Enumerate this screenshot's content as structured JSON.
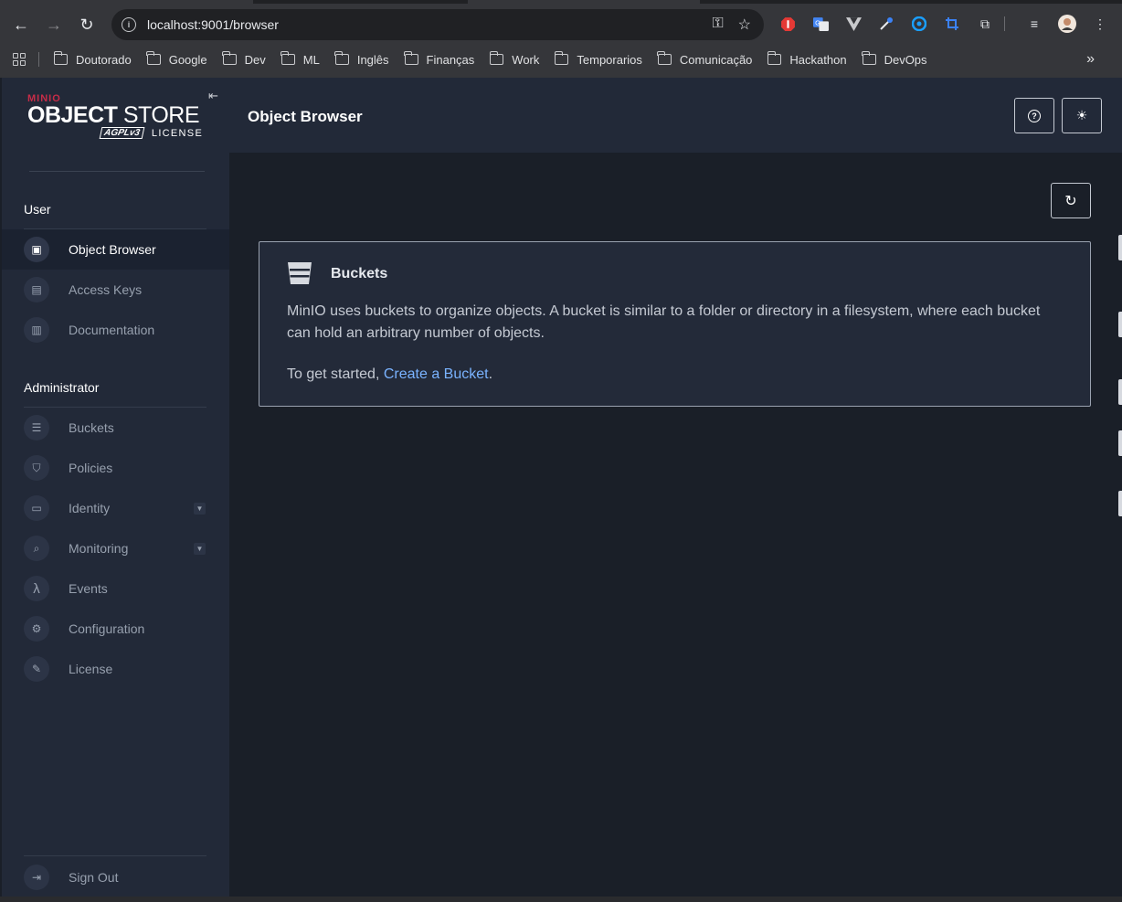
{
  "browser": {
    "url": "localhost:9001/browser",
    "bookmarks": [
      "Doutorado",
      "Google",
      "Dev",
      "ML",
      "Inglês",
      "Finanças",
      "Work",
      "Temporarios",
      "Comunicação",
      "Hackathon",
      "DevOps"
    ]
  },
  "logo": {
    "brand": "MINIO",
    "product_bold": "OBJECT",
    "product_light": " STORE",
    "license_badge": "AGPLv3",
    "license_word": "LICENSE"
  },
  "sidebar": {
    "user_section": "User",
    "user_items": [
      {
        "label": "Object Browser",
        "icon": "object-browser-icon"
      },
      {
        "label": "Access Keys",
        "icon": "access-keys-icon"
      },
      {
        "label": "Documentation",
        "icon": "documentation-icon"
      }
    ],
    "admin_section": "Administrator",
    "admin_items": [
      {
        "label": "Buckets",
        "icon": "bucket-icon"
      },
      {
        "label": "Policies",
        "icon": "shield-icon"
      },
      {
        "label": "Identity",
        "icon": "id-card-icon"
      },
      {
        "label": "Monitoring",
        "icon": "magnifier-icon"
      },
      {
        "label": "Events",
        "icon": "lambda-icon"
      },
      {
        "label": "Configuration",
        "icon": "gear-icon"
      },
      {
        "label": "License",
        "icon": "license-icon"
      }
    ],
    "sign_out": "Sign Out"
  },
  "header": {
    "title": "Object Browser"
  },
  "card": {
    "title": "Buckets",
    "body": "MinIO uses buckets to organize objects. A bucket is similar to a folder or directory in a filesystem, where each bucket can hold an arbitrary number of objects.",
    "cta_prefix": "To get started, ",
    "cta_link": "Create a Bucket",
    "cta_suffix": "."
  },
  "colors": {
    "sidebar_bg": "#222938",
    "main_bg": "#1a1f28",
    "link": "#7ab3ff",
    "brand_red": "#c72c48"
  }
}
